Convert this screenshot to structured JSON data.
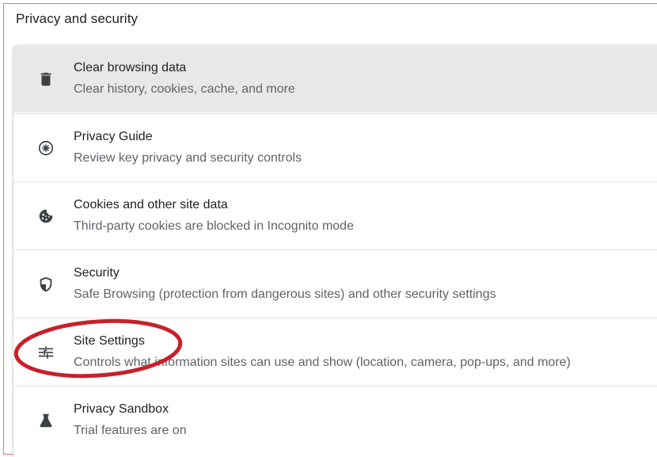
{
  "section": {
    "title": "Privacy and security"
  },
  "items": [
    {
      "title": "Clear browsing data",
      "subtitle": "Clear history, cookies, cache, and more",
      "icon": "trash-icon"
    },
    {
      "title": "Privacy Guide",
      "subtitle": "Review key privacy and security controls",
      "icon": "compass-icon"
    },
    {
      "title": "Cookies and other site data",
      "subtitle": "Third-party cookies are blocked in Incognito mode",
      "icon": "cookie-icon"
    },
    {
      "title": "Security",
      "subtitle": "Safe Browsing (protection from dangerous sites) and other security settings",
      "icon": "shield-icon"
    },
    {
      "title": "Site Settings",
      "subtitle": "Controls what information sites can use and show (location, camera, pop-ups, and more)",
      "icon": "tune-icon"
    },
    {
      "title": "Privacy Sandbox",
      "subtitle": "Trial features are on",
      "icon": "flask-icon"
    }
  ],
  "colors": {
    "annotation": "#c8202a",
    "hover_row": "#e8e8e8",
    "icon": "#3c4043"
  }
}
